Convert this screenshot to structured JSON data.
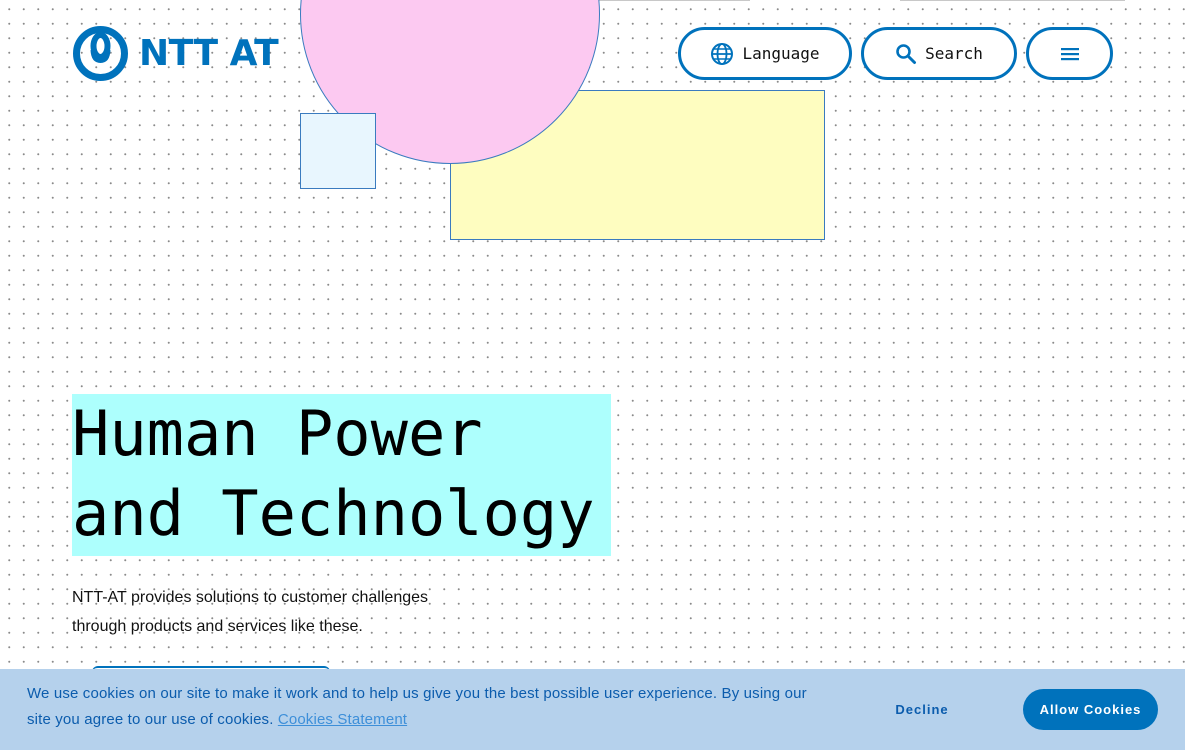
{
  "header": {
    "logo_text": "NTT AT",
    "language_label": "Language",
    "search_label": "Search",
    "icons": {
      "language": "globe-icon",
      "search": "search-icon",
      "menu": "hamburger-menu-icon"
    }
  },
  "hero": {
    "title_line1": "Human Power",
    "title_line2": "and Technology",
    "description_line1": "NTT-AT provides solutions to customer challenges",
    "description_line2": "through products and services like these."
  },
  "cookie_banner": {
    "message": "We use cookies on our site to make it work and to help us give you the best possible user experience. By using our site you agree to our use of cookies. ",
    "link_label": "Cookies Statement",
    "decline_label": "Decline",
    "allow_label": "Allow Cookies"
  },
  "colors": {
    "brand_blue": "#0072bc",
    "hero_highlight": "#adfffd",
    "circle_pink": "#fcc9f1",
    "rect_yellow": "#fefdc0",
    "square_light_blue": "#e8f6fe",
    "cookie_bg": "#b5d1ec"
  }
}
